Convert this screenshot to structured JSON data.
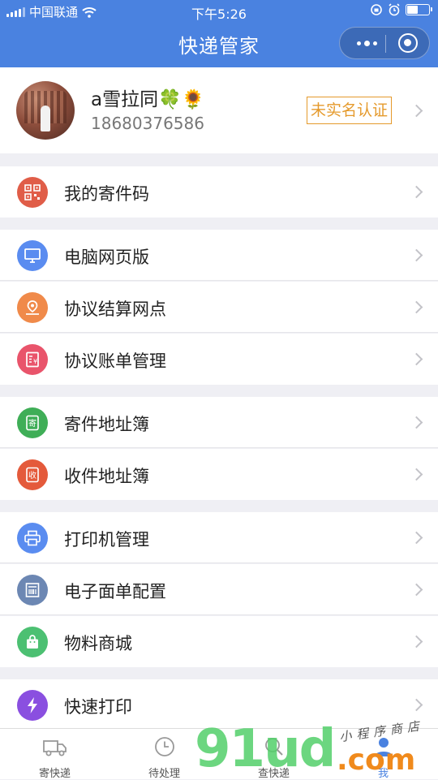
{
  "status_bar": {
    "carrier": "中国联通",
    "time": "下午5:26"
  },
  "nav": {
    "title": "快递管家"
  },
  "profile": {
    "name": "a雪拉同🍀🌻",
    "phone": "18680376586",
    "verify_badge": "未实名认证"
  },
  "menu": {
    "qr": {
      "label": "我的寄件码",
      "color": "#e05d48",
      "icon": "qr-code-icon"
    },
    "web": {
      "label": "电脑网页版",
      "color": "#5a8cf0",
      "icon": "monitor-icon"
    },
    "outlet": {
      "label": "协议结算网点",
      "color": "#f08a4a",
      "icon": "map-pin-icon"
    },
    "bill": {
      "label": "协议账单管理",
      "color": "#e9546b",
      "icon": "bill-icon"
    },
    "send_book": {
      "label": "寄件地址簿",
      "color": "#3fae57",
      "icon": "send-book-icon",
      "glyph": "寄"
    },
    "recv_book": {
      "label": "收件地址簿",
      "color": "#e45a3b",
      "icon": "receive-book-icon",
      "glyph": "收"
    },
    "printer": {
      "label": "打印机管理",
      "color": "#5a8cf0",
      "icon": "printer-icon"
    },
    "waybill": {
      "label": "电子面单配置",
      "color": "#6c87b3",
      "icon": "waybill-icon"
    },
    "shop": {
      "label": "物料商城",
      "color": "#4cc072",
      "icon": "shopping-bag-icon"
    },
    "quick_print": {
      "label": "快速打印",
      "color": "#8a4fe0",
      "icon": "lightning-icon"
    }
  },
  "tabbar": {
    "send": "寄快递",
    "pending": "待处理",
    "query": "查快递",
    "me": "我"
  },
  "watermark": {
    "brand": "91ud",
    "domain": ".com",
    "subtitle": "小程序商店"
  }
}
